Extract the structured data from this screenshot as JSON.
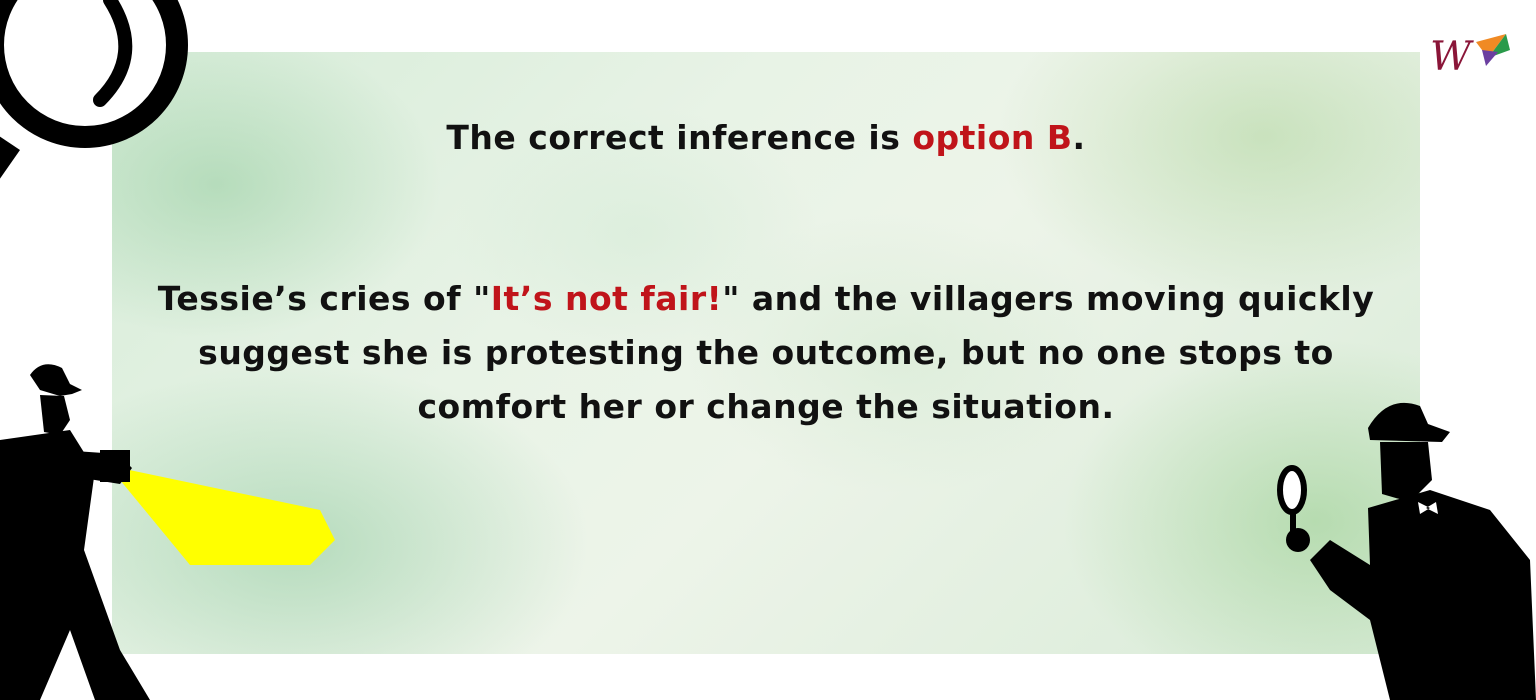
{
  "slide": {
    "title": {
      "prefix": "The correct inference is ",
      "highlight": "option B",
      "suffix": "."
    },
    "body": {
      "part1": "Tessie’s cries of \"",
      "quote": "It’s not fair!",
      "part2": "\" and the villagers moving quickly suggest she is protesting the outcome, but no one stops to comfort her or change the situation."
    }
  },
  "colors": {
    "text": "#111111",
    "highlight": "#c0141a",
    "flashlight_beam": "#ffff00",
    "silhouette": "#000000"
  },
  "icons": [
    "magnifying-glass-icon",
    "detective-flashlight-icon",
    "detective-magnifier-icon",
    "brand-logo-icon"
  ]
}
